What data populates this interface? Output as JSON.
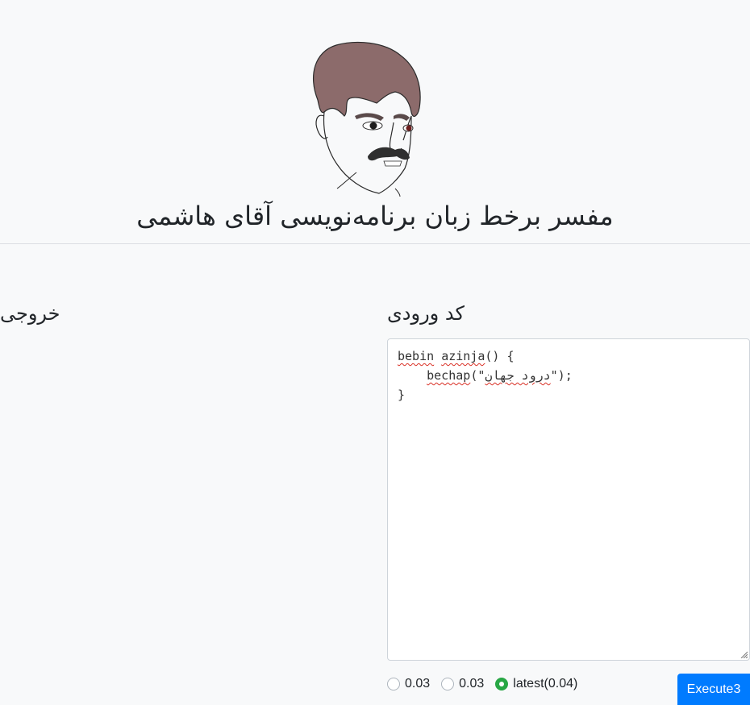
{
  "header": {
    "title": "مفسر برخط زبان برنامه‌نویسی آقای هاشمی",
    "logo_icon": "mustached-man-caricature-icon"
  },
  "output": {
    "heading": "خروجی"
  },
  "input": {
    "heading": "کد ورودی",
    "code_lines": [
      "bebin azinja() {",
      "    bechap(\"درود جهان\");",
      "}"
    ]
  },
  "versions": [
    {
      "label": "0.03",
      "checked": false
    },
    {
      "label": "0.03",
      "checked": false
    },
    {
      "label": "latest(0.04)",
      "checked": true
    }
  ],
  "execute_label": "Execute3",
  "colors": {
    "primary": "#007bff",
    "radio_checked": "#28a745",
    "background": "#f8f9fa"
  }
}
